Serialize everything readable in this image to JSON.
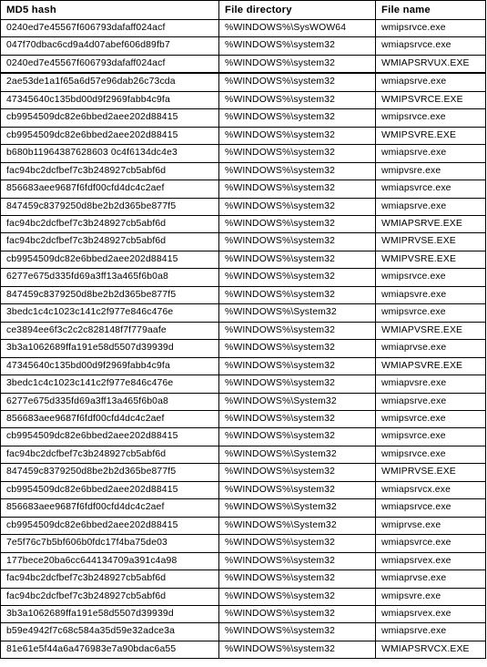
{
  "table": {
    "columns": [
      "MD5 hash",
      "File directory",
      "File name"
    ],
    "thick_rule_after_row_index": 2,
    "rows": [
      [
        "0240ed7e45567f606793dafaff024acf",
        "%WINDOWS%\\SysWOW64",
        "wmipsrvce.exe"
      ],
      [
        "047f70dbac6cd9a4d07abef606d89fb7",
        "%WINDOWS%\\system32",
        "wmiapsrvce.exe"
      ],
      [
        "0240ed7e45567f606793dafaff024acf",
        "%WINDOWS%\\system32",
        "WMIAPSRVUX.EXE"
      ],
      [
        "2ae53de1a1f65a6d57e96dab26c73cda",
        "%WINDOWS%\\system32",
        "wmiapsrve.exe"
      ],
      [
        "47345640c135bd00d9f2969fabb4c9fa",
        "%WINDOWS%\\system32",
        "WMIPSVRCE.EXE"
      ],
      [
        "cb9954509dc82e6bbed2aee202d88415",
        "%WINDOWS%\\system32",
        "wmipsrvce.exe"
      ],
      [
        "cb9954509dc82e6bbed2aee202d88415",
        "%WINDOWS%\\system32",
        "WMIPSVRE.EXE"
      ],
      [
        "b680b11964387628603 0c4f6134dc4e3",
        "%WINDOWS%\\system32",
        "wmiapsrve.exe"
      ],
      [
        "fac94bc2dcfbef7c3b248927cb5abf6d",
        "%WINDOWS%\\system32",
        "wmipvsre.exe"
      ],
      [
        "856683aee9687f6fdf00cfd4dc4c2aef",
        "%WINDOWS%\\system32",
        "wmiapsvrce.exe"
      ],
      [
        "847459c8379250d8be2b2d365be877f5",
        "%WINDOWS%\\system32",
        "wmiapsrve.exe"
      ],
      [
        "fac94bc2dcfbef7c3b248927cb5abf6d",
        "%WINDOWS%\\system32",
        "WMIAPSRVE.EXE"
      ],
      [
        "fac94bc2dcfbef7c3b248927cb5abf6d",
        "%WINDOWS%\\system32",
        "WMIPRVSE.EXE"
      ],
      [
        "cb9954509dc82e6bbed2aee202d88415",
        "%WINDOWS%\\system32",
        "WMIPVSRE.EXE"
      ],
      [
        "6277e675d335fd69a3ff13a465f6b0a8",
        "%WINDOWS%\\system32",
        "wmipsrvce.exe"
      ],
      [
        "847459c8379250d8be2b2d365be877f5",
        "%WINDOWS%\\system32",
        "wmiapsvre.exe"
      ],
      [
        "3bedc1c4c1023c141c2f977e846c476e",
        "%WINDOWS%\\System32",
        "wmipsvrce.exe"
      ],
      [
        "ce3894ee6f3c2c2c828148f7f779aafe",
        "%WINDOWS%\\system32",
        "WMIAPVSRE.EXE"
      ],
      [
        "3b3a1062689ffa191e58d5507d39939d",
        "%WINDOWS%\\system32",
        "wmiaprvse.exe"
      ],
      [
        "47345640c135bd00d9f2969fabb4c9fa",
        "%WINDOWS%\\system32",
        "WMIAPSVRE.EXE"
      ],
      [
        "3bedc1c4c1023c141c2f977e846c476e",
        "%WINDOWS%\\system32",
        "wmiapvsre.exe"
      ],
      [
        "6277e675d335fd69a3ff13a465f6b0a8",
        "%WINDOWS%\\System32",
        "wmiapsrve.exe"
      ],
      [
        "856683aee9687f6fdf00cfd4dc4c2aef",
        "%WINDOWS%\\system32",
        "wmipsvrce.exe"
      ],
      [
        "cb9954509dc82e6bbed2aee202d88415",
        "%WINDOWS%\\system32",
        "wmipsvrce.exe"
      ],
      [
        "fac94bc2dcfbef7c3b248927cb5abf6d",
        "%WINDOWS%\\System32",
        "wmipsrvce.exe"
      ],
      [
        "847459c8379250d8be2b2d365be877f5",
        "%WINDOWS%\\system32",
        "WMIPRVSE.EXE"
      ],
      [
        "cb9954509dc82e6bbed2aee202d88415",
        "%WINDOWS%\\system32",
        "wmiapsrvcx.exe"
      ],
      [
        "856683aee9687f6fdf00cfd4dc4c2aef",
        "%WINDOWS%\\System32",
        "wmiapsrvce.exe"
      ],
      [
        "cb9954509dc82e6bbed2aee202d88415",
        "%WINDOWS%\\System32",
        "wmiprvse.exe"
      ],
      [
        "7e5f76c7b5bf606b0fdc17f4ba75de03",
        "%WINDOWS%\\system32",
        "wmiapsvrce.exe"
      ],
      [
        "177bece20ba6cc644134709a391c4a98",
        "%WINDOWS%\\system32",
        "wmiapsrvex.exe"
      ],
      [
        "fac94bc2dcfbef7c3b248927cb5abf6d",
        "%WINDOWS%\\system32",
        "wmiaprvse.exe"
      ],
      [
        "fac94bc2dcfbef7c3b248927cb5abf6d",
        "%WINDOWS%\\system32",
        "wmipsvre.exe"
      ],
      [
        "3b3a1062689ffa191e58d5507d39939d",
        "%WINDOWS%\\system32",
        "wmiapsrvex.exe"
      ],
      [
        "b59e4942f7c68c584a35d59e32adce3a",
        "%WINDOWS%\\system32",
        "wmiapsrve.exe"
      ],
      [
        "81e61e5f44a6a476983e7a90bdac6a55",
        "%WINDOWS%\\system32",
        "WMIAPSRVCX.EXE"
      ]
    ]
  }
}
